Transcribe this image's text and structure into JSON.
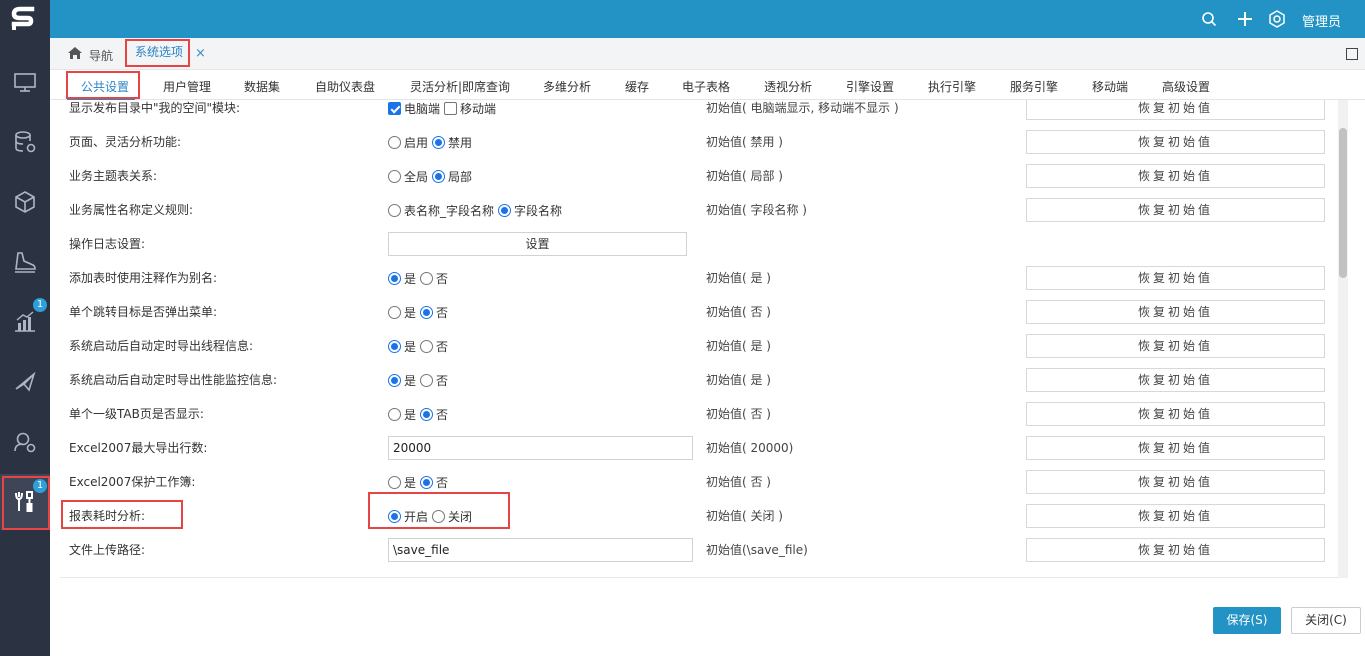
{
  "header": {
    "admin_label": "管理员",
    "icons": [
      "search-icon",
      "plus-icon",
      "theme-icon"
    ]
  },
  "sidebar": {
    "logo": "S",
    "items": [
      {
        "icon": "monitor-icon"
      },
      {
        "icon": "database-gear-icon"
      },
      {
        "icon": "cube-icon"
      },
      {
        "icon": "shoe-icon"
      },
      {
        "icon": "chart-icon",
        "badge": "1"
      },
      {
        "icon": "send-icon"
      },
      {
        "icon": "user-settings-icon"
      },
      {
        "icon": "tools-icon",
        "badge": "1",
        "active": true
      }
    ]
  },
  "tabs": {
    "nav_label": "导航",
    "active_tab": "系统选项",
    "close_symbol": "×"
  },
  "subtabs": [
    "公共设置",
    "用户管理",
    "数据集",
    "自助仪表盘",
    "灵活分析|即席查询",
    "多维分析",
    "缓存",
    "电子表格",
    "透视分析",
    "引擎设置",
    "执行引擎",
    "服务引擎",
    "移动端",
    "高级设置"
  ],
  "reset_label": "恢复初始值",
  "rows": [
    {
      "label": "显示发布目录中\"我的空间\"模块:",
      "opt1": "电脑端",
      "opt2": "移动端",
      "init": "初始值( 电脑端显示, 移动端不显示 )"
    },
    {
      "label": "页面、灵活分析功能:",
      "opt1": "启用",
      "opt2": "禁用",
      "init": "初始值( 禁用 )"
    },
    {
      "label": "业务主题表关系:",
      "opt1": "全局",
      "opt2": "局部",
      "init": "初始值( 局部 )"
    },
    {
      "label": "业务属性名称定义规则:",
      "opt1": "表名称_字段名称",
      "opt2": "字段名称",
      "init": "初始值( 字段名称 )"
    },
    {
      "label": "操作日志设置:",
      "button": "设置"
    },
    {
      "label": "添加表时使用注释作为别名:",
      "opt1": "是",
      "opt2": "否",
      "init": "初始值( 是 )"
    },
    {
      "label": "单个跳转目标是否弹出菜单:",
      "opt1": "是",
      "opt2": "否",
      "init": "初始值( 否 )"
    },
    {
      "label": "系统启动后自动定时导出线程信息:",
      "opt1": "是",
      "opt2": "否",
      "init": "初始值( 是 )"
    },
    {
      "label": "系统启动后自动定时导出性能监控信息:",
      "opt1": "是",
      "opt2": "否",
      "init": "初始值( 是 )"
    },
    {
      "label": "单个一级TAB页是否显示:",
      "opt1": "是",
      "opt2": "否",
      "init": "初始值( 否 )"
    },
    {
      "label": "Excel2007最大导出行数:",
      "value": "20000",
      "init": "初始值( 20000)"
    },
    {
      "label": "Excel2007保护工作簿:",
      "opt1": "是",
      "opt2": "否",
      "init": "初始值( 否 )"
    },
    {
      "label": "报表耗时分析:",
      "opt1": "开启",
      "opt2": "关闭",
      "init": "初始值( 关闭 )"
    },
    {
      "label": "文件上传路径:",
      "value": "\\save_file",
      "init": "初始值(\\save_file)"
    }
  ],
  "footer": {
    "save_label": "保存(S)",
    "close_label": "关闭(C)"
  },
  "colors": {
    "topbar": "#2393c6",
    "sidebar": "#2b3242",
    "accent": "#2b84c4",
    "highlight": "#e64545"
  }
}
